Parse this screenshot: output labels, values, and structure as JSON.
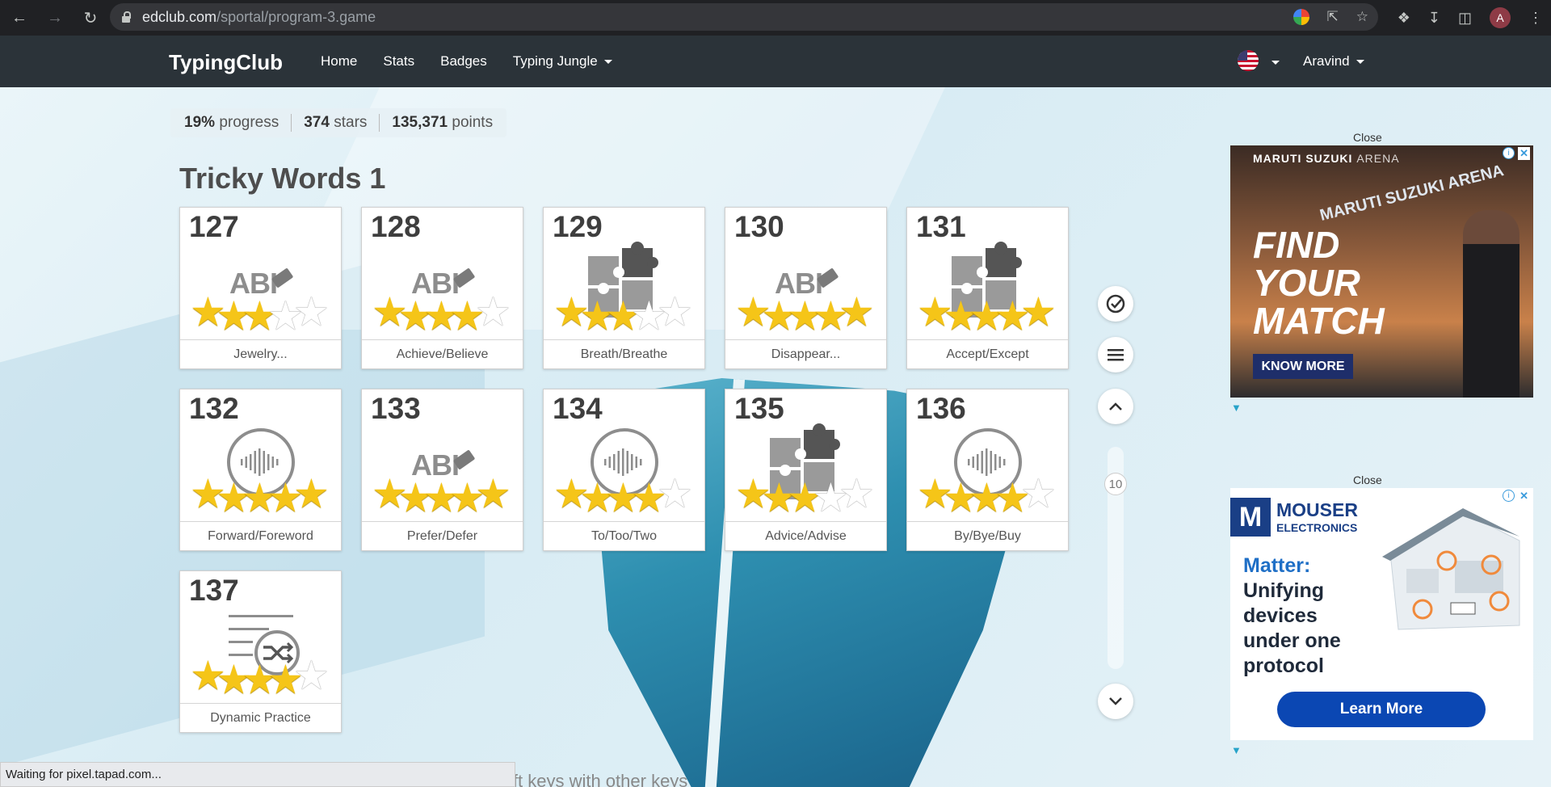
{
  "browser": {
    "url_host": "edclub.com",
    "url_path": "/sportal/program-3.game",
    "profile_initial": "A"
  },
  "navbar": {
    "brand": "TypingClub",
    "links": [
      "Home",
      "Stats",
      "Badges",
      "Typing Jungle"
    ],
    "user": "Aravind"
  },
  "progress": {
    "percent": "19%",
    "percent_label": "progress",
    "stars": "374",
    "stars_label": "stars",
    "points": "135,371",
    "points_label": "points"
  },
  "section_title": "Tricky Words 1",
  "lessons": [
    {
      "num": "127",
      "label": "Jewelry...",
      "icon": "abc-eraser-icon",
      "stars": 3
    },
    {
      "num": "128",
      "label": "Achieve/Believe",
      "icon": "abc-eraser-icon",
      "stars": 4
    },
    {
      "num": "129",
      "label": "Breath/Breathe",
      "icon": "puzzle-icon",
      "stars": 3
    },
    {
      "num": "130",
      "label": "Disappear...",
      "icon": "abc-eraser-icon",
      "stars": 5
    },
    {
      "num": "131",
      "label": "Accept/Except",
      "icon": "puzzle-icon",
      "stars": 5
    },
    {
      "num": "132",
      "label": "Forward/Foreword",
      "icon": "sound-icon",
      "stars": 5
    },
    {
      "num": "133",
      "label": "Prefer/Defer",
      "icon": "abc-eraser-icon",
      "stars": 5
    },
    {
      "num": "134",
      "label": "To/Too/Two",
      "icon": "sound-icon",
      "stars": 4
    },
    {
      "num": "135",
      "label": "Advice/Advise",
      "icon": "puzzle-icon",
      "stars": 3
    },
    {
      "num": "136",
      "label": "By/Bye/Buy",
      "icon": "sound-icon",
      "stars": 4
    },
    {
      "num": "137",
      "label": "Dynamic Practice",
      "icon": "shuffle-icon",
      "stars": 4
    }
  ],
  "icon_text": "ABI",
  "scroll_level": "10",
  "ads": {
    "close_text": "Close",
    "ad1": {
      "brand_strong": "MARUTI SUZUKI",
      "brand_light": "ARENA",
      "sign": "MARUTI SUZUKI ARENA",
      "headline": [
        "FIND",
        "YOUR",
        "MATCH"
      ],
      "cta": "KNOW MORE"
    },
    "ad2": {
      "logo_letter": "M",
      "brand": "MOUSER",
      "brand_sub": "ELECTRONICS",
      "title": "Matter:",
      "desc": [
        "Unifying",
        "devices",
        "under one",
        "protocol"
      ],
      "cta": "Learn More"
    }
  },
  "status_text": "Waiting for pixel.tapad.com...",
  "behind_text": "ift keys with other keys"
}
